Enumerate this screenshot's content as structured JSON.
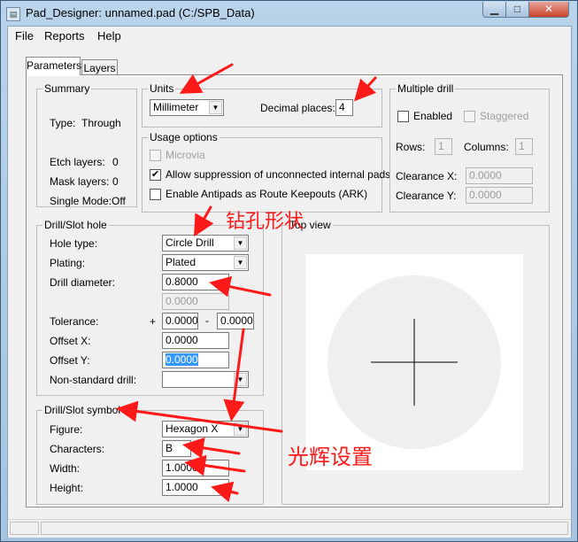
{
  "window": {
    "title": "Pad_Designer: unnamed.pad (C:/SPB_Data)"
  },
  "menu": {
    "file": "File",
    "reports": "Reports",
    "help": "Help"
  },
  "tabs": {
    "parameters": "Parameters",
    "layers": "Layers"
  },
  "summary": {
    "title": "Summary",
    "type_label": "Type:",
    "type_value": "Through",
    "etch_label": "Etch layers:",
    "etch_value": "0",
    "mask_label": "Mask layers:",
    "mask_value": "0",
    "single_label": "Single Mode:",
    "single_value": "Off"
  },
  "units": {
    "title": "Units",
    "unit_value": "Millimeter",
    "decimal_label": "Decimal places:",
    "decimal_value": "4"
  },
  "usage": {
    "title": "Usage options",
    "microvia": "Microvia",
    "allow_suppression": "Allow suppression of unconnected internal pads",
    "allow_checked": "✔",
    "antipads": "Enable Antipads as Route Keepouts (ARK)"
  },
  "multiple_drill": {
    "title": "Multiple drill",
    "enabled": "Enabled",
    "staggered": "Staggered",
    "rows_label": "Rows:",
    "rows_value": "1",
    "cols_label": "Columns:",
    "cols_value": "1",
    "clrx_label": "Clearance X:",
    "clrx_value": "0.0000",
    "clry_label": "Clearance Y:",
    "clry_value": "0.0000"
  },
  "drill": {
    "title": "Drill/Slot hole",
    "hole_type_label": "Hole type:",
    "hole_type_value": "Circle Drill",
    "plating_label": "Plating:",
    "plating_value": "Plated",
    "diameter_label": "Drill diameter:",
    "diameter_value": "0.8000",
    "diameter2_value": "0.0000",
    "tolerance_label": "Tolerance:",
    "tol_plus": "+",
    "tol_plus_value": "0.0000",
    "tol_minus": "-",
    "tol_minus_value": "0.0000",
    "offx_label": "Offset X:",
    "offx_value": "0.0000",
    "offy_label": "Offset Y:",
    "offy_value": "0.0000",
    "nonstd_label": "Non-standard drill:",
    "nonstd_value": ""
  },
  "symbol": {
    "title": "Drill/Slot symbol",
    "figure_label": "Figure:",
    "figure_value": "Hexagon X",
    "chars_label": "Characters:",
    "chars_value": "B",
    "width_label": "Width:",
    "width_value": "1.0000",
    "height_label": "Height:",
    "height_value": "1.0000"
  },
  "top_view": {
    "title": "Top view"
  },
  "annotations": {
    "drill_shape": "钻孔形状",
    "glow_settings": "光辉设置"
  },
  "colors": {
    "annotation": "#ff1a1a",
    "selection": "#3399ff",
    "preview_disc": "#efefef"
  }
}
